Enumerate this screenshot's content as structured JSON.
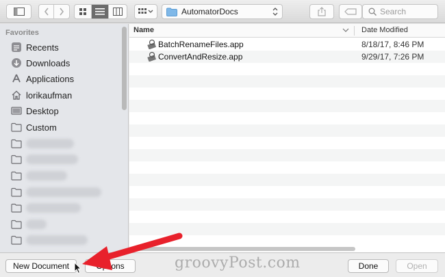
{
  "toolbar": {
    "folder_name": "AutomatorDocs",
    "search_placeholder": "Search"
  },
  "sidebar": {
    "section_title": "Favorites",
    "items": [
      {
        "label": "Recents",
        "icon": "recents-icon"
      },
      {
        "label": "Downloads",
        "icon": "downloads-icon"
      },
      {
        "label": "Applications",
        "icon": "applications-icon"
      },
      {
        "label": "lorikaufman",
        "icon": "home-icon"
      },
      {
        "label": "Desktop",
        "icon": "desktop-icon"
      },
      {
        "label": "Custom",
        "icon": "folder-icon"
      }
    ]
  },
  "file_list": {
    "columns": {
      "name": "Name",
      "date": "Date Modified"
    },
    "rows": [
      {
        "name": "BatchRenameFiles.app",
        "date": "8/18/17, 8:46 PM",
        "icon": "automator-app-icon"
      },
      {
        "name": "ConvertAndResize.app",
        "date": "9/29/17, 7:26 PM",
        "icon": "automator-app-icon"
      }
    ]
  },
  "bottom": {
    "new_document": "New Document",
    "options": "Options",
    "done": "Done",
    "open": "Open",
    "watermark": "groovyPost.com"
  },
  "colors": {
    "annotation_arrow": "#e8212b",
    "active_view": "#6c6c6c"
  }
}
